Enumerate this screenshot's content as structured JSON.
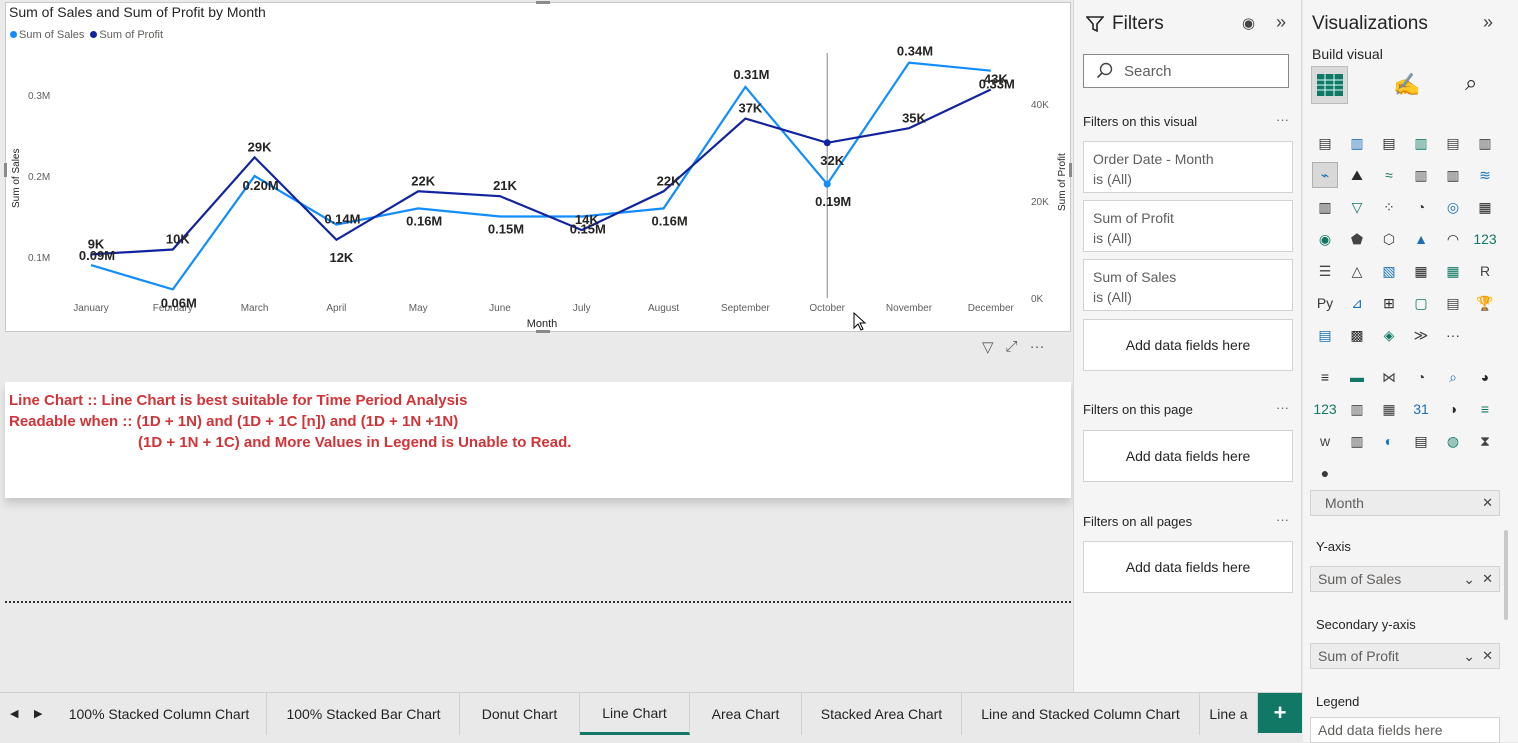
{
  "chart": {
    "title": "Sum of Sales and Sum of Profit by Month",
    "legend": [
      {
        "label": "Sum of Sales",
        "color": "#118dff"
      },
      {
        "label": "Sum of Profit",
        "color": "#12239e"
      }
    ]
  },
  "chart_data": {
    "type": "line",
    "title": "Sum of Sales and Sum of Profit by Month",
    "xlabel": "Month",
    "ylabel": "Sum of Sales",
    "y2label": "Sum of Profit",
    "categories": [
      "January",
      "February",
      "March",
      "April",
      "May",
      "June",
      "July",
      "August",
      "September",
      "October",
      "November",
      "December"
    ],
    "ylim": [
      0.05,
      0.3
    ],
    "y_ticks": [
      "0.1M",
      "0.2M",
      "0.3M"
    ],
    "y2lim": [
      0,
      47
    ],
    "y2_ticks": [
      "0K",
      "20K",
      "40K"
    ],
    "series": [
      {
        "name": "Sum of Sales",
        "axis": "left",
        "color": "#118dff",
        "values": [
          0.09,
          0.06,
          0.2,
          0.14,
          0.16,
          0.15,
          0.15,
          0.16,
          0.31,
          0.19,
          0.34,
          0.33
        ],
        "labels": [
          "0.09M",
          "0.06M",
          "0.20M",
          "0.14M",
          "0.16M",
          "0.15M",
          "0.15M",
          "0.16M",
          "0.31M",
          "0.19M",
          "0.34M",
          "0.33M"
        ]
      },
      {
        "name": "Sum of Profit",
        "axis": "right",
        "color": "#12239e",
        "values": [
          9,
          10,
          29,
          12,
          22,
          21,
          14,
          22,
          37,
          32,
          35,
          43
        ],
        "labels": [
          "9K",
          "10K",
          "29K",
          "12K",
          "22K",
          "21K",
          "14K",
          "22K",
          "37K",
          "32K",
          "35K",
          "43K"
        ]
      }
    ],
    "grid": false,
    "legend_position": "top-left"
  },
  "textbox": {
    "line1": "Line Chart :: Line Chart is best suitable for Time Period Analysis",
    "line2": "Readable when :: (1D  + 1N) and (1D + 1C [n]) and (1D + 1N +1N)",
    "line3": "(1D + 1N + 1C) and More Values in Legend is Unable to Read."
  },
  "filters": {
    "title": "Filters",
    "search_placeholder": "Search",
    "on_visual": "Filters on this visual",
    "cards": [
      {
        "name": "Order Date - Month",
        "state": "is (All)"
      },
      {
        "name": "Sum of Profit",
        "state": "is (All)"
      },
      {
        "name": "Sum of Sales",
        "state": "is (All)"
      }
    ],
    "add_fields": "Add data fields here",
    "on_page": "Filters on this page",
    "on_all": "Filters on all pages",
    "more": "···"
  },
  "visualizations": {
    "title": "Visualizations",
    "build": "Build visual",
    "x_axis_field": "Month",
    "y_axis_label": "Y-axis",
    "y_axis_field": "Sum of Sales",
    "secondary_label": "Secondary y-axis",
    "secondary_field": "Sum of Profit",
    "legend_label": "Legend",
    "legend_add": "Add data fields here",
    "icons_rows": [
      [
        "▤",
        "▥",
        "▤",
        "▥",
        "▤",
        "▥"
      ],
      [
        "⌁",
        "⛰",
        "≈",
        "▥",
        "▥",
        "≋"
      ],
      [
        "▥",
        "▽",
        "⁘",
        "◔",
        "◎",
        "▦"
      ],
      [
        "◉",
        "⬟",
        "⬡",
        "▲",
        "◠",
        "123"
      ],
      [
        "☰",
        "△",
        "▧",
        "▦",
        "▦",
        "R"
      ],
      [
        "Py",
        "⊿",
        "⊞",
        "▢",
        "▤",
        "🏆"
      ],
      [
        "▤",
        "▩",
        "◈",
        "≫",
        "···",
        ""
      ],
      [
        "≡",
        "▬",
        "⋈",
        "◔",
        "⌕",
        "◕"
      ],
      [
        "123",
        "▥",
        "▦",
        "31",
        "◑",
        "≡"
      ],
      [
        "w",
        "▥",
        "◐",
        "▤",
        "◍",
        "⧗"
      ],
      [
        "●",
        "",
        "",
        "",
        "",
        ""
      ]
    ]
  },
  "tabs": [
    "100% Stacked Column Chart",
    "100% Stacked Bar Chart",
    "Donut Chart",
    "Line Chart",
    "Area Chart",
    "Stacked Area Chart",
    "Line and Stacked Column Chart",
    "Line a"
  ],
  "active_tab": "Line Chart",
  "add_tab": "+"
}
